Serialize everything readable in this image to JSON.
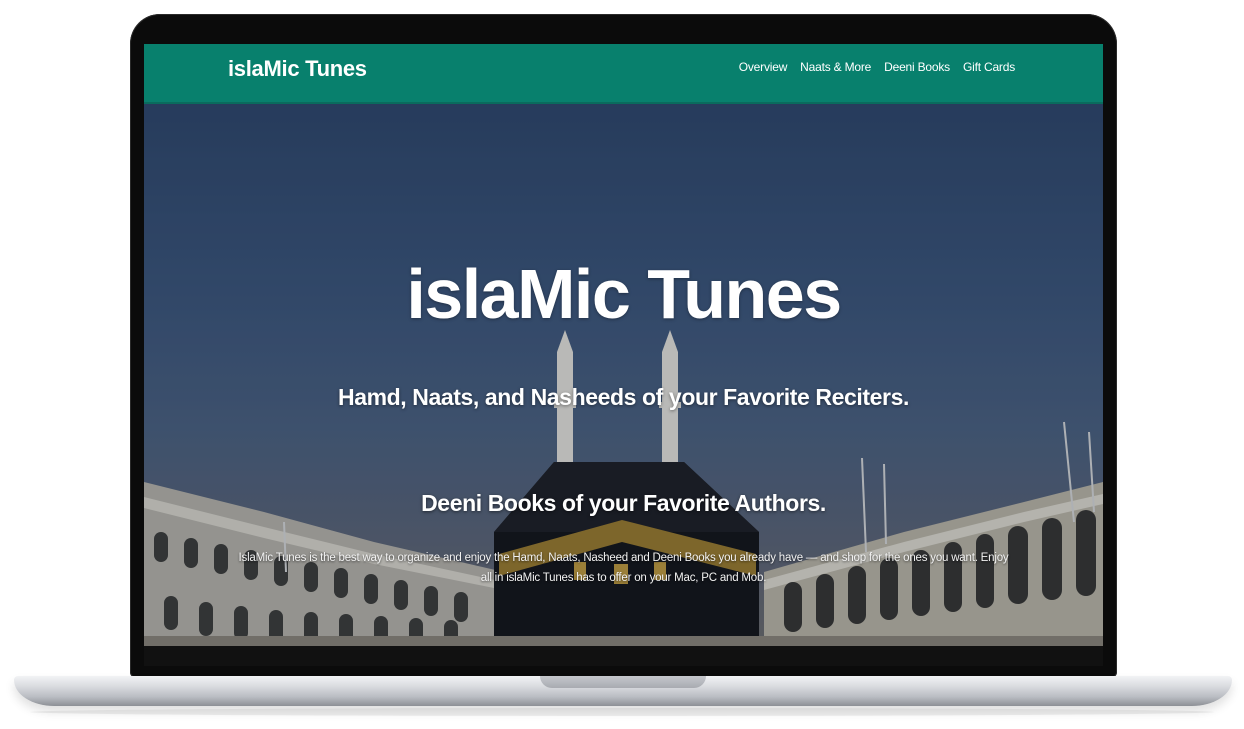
{
  "site": {
    "brand": "islaMic Tunes"
  },
  "nav": {
    "items": [
      {
        "label": "Overview"
      },
      {
        "label": "Naats & More"
      },
      {
        "label": "Deeni Books"
      },
      {
        "label": "Gift Cards"
      }
    ]
  },
  "hero": {
    "title": "islaMic Tunes",
    "subtitle_1": "Hamd, Naats, and Nasheeds of your Favorite Reciters.",
    "subtitle_2": "Deeni Books of your Favorite Authors.",
    "description": "IslaMic Tunes is the best way to organize and enjoy the Hamd, Naats, Nasheed and Deeni Books you already have — and shop for the ones you want. Enjoy all in islaMic Tunes has to offer on your Mac, PC and Mob."
  },
  "colors": {
    "navbar": "#08806d",
    "text": "#ffffff",
    "laptop_bezel": "#0b0b0b"
  }
}
